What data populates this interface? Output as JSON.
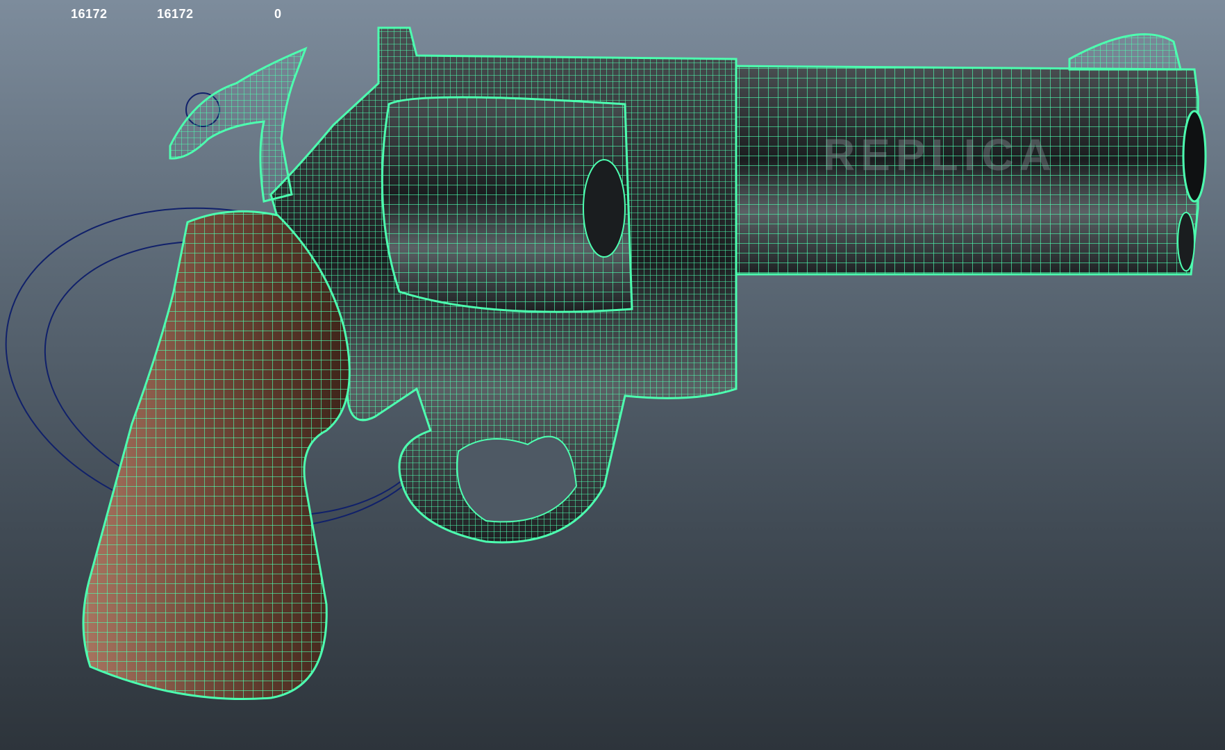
{
  "hud": {
    "value_1": "16172",
    "value_2": "16172",
    "value_3": "0"
  },
  "watermark": {
    "text": "REPLICA"
  },
  "colors": {
    "wireframe": "#4dffb0",
    "grip": "#7a5040",
    "metal": "#2a2e30",
    "manipulator": "#10206a"
  }
}
